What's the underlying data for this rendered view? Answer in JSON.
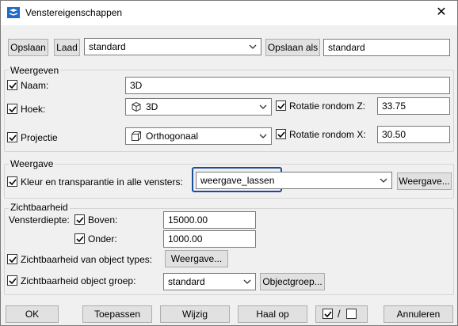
{
  "window": {
    "title": "Venstereigenschappen",
    "close_glyph": "✕"
  },
  "toolbar": {
    "save_label": "Opslaan",
    "load_label": "Laad",
    "preset_value": "standard",
    "save_as_label": "Opslaan als",
    "save_as_value": "standard"
  },
  "weergeven": {
    "title": "Weergeven",
    "naam_label": "Naam:",
    "naam_value": "3D",
    "naam_checked": true,
    "hoek_label": "Hoek:",
    "hoek_value": "3D",
    "hoek_checked": true,
    "rotz_label": "Rotatie rondom Z:",
    "rotz_value": "33.75",
    "rotz_checked": true,
    "projectie_label": "Projectie",
    "projectie_value": "Orthogonaal",
    "projectie_checked": true,
    "rotx_label": "Rotatie rondom X:",
    "rotx_value": "30.50",
    "rotx_checked": true
  },
  "weergave": {
    "title": "Weergave",
    "kleur_label": "Kleur en transparantie in alle vensters:",
    "kleur_checked": true,
    "kleur_value": "weergave_lassen",
    "weergave_button": "Weergave..."
  },
  "zichtbaarheid": {
    "title": "Zichtbaarheid",
    "diepte_label": "Vensterdiepte:",
    "boven_label": "Boven:",
    "boven_checked": true,
    "boven_value": "15000.00",
    "onder_label": "Onder:",
    "onder_checked": true,
    "onder_value": "1000.00",
    "types_label": "Zichtbaarheid van object types:",
    "types_checked": true,
    "types_button": "Weergave...",
    "groep_label": "Zichtbaarheid object groep:",
    "groep_checked": true,
    "groep_value": "standard",
    "groep_button": "Objectgroep..."
  },
  "footer": {
    "ok": "OK",
    "apply": "Toepassen",
    "modify": "Wijzig",
    "get": "Haal op",
    "toggle_separator": "/",
    "cancel": "Annuleren"
  },
  "icons": {
    "app": "app-view-icon",
    "angle": "cube-3d-icon",
    "projection": "cube-ortho-icon"
  },
  "colors": {
    "focus": "#1c4d9c",
    "accent": "#1e6bc8"
  }
}
